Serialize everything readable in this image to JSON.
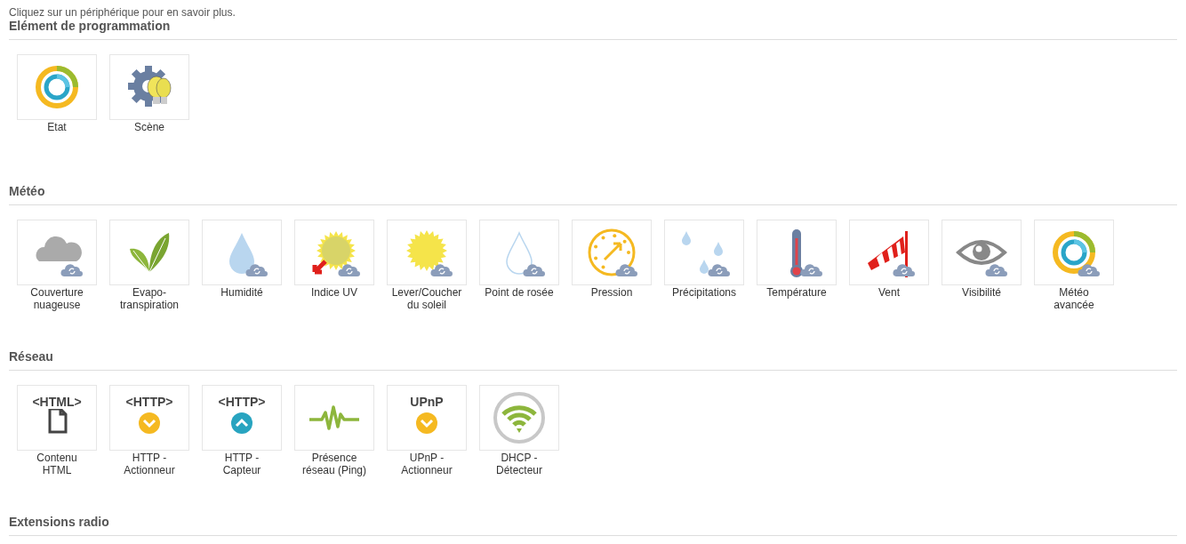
{
  "intro": "Cliquez sur un périphérique pour en savoir plus.",
  "sections": [
    {
      "title": "Elément de programmation",
      "devices": [
        {
          "label": "Etat",
          "kind": "donut",
          "badge": false
        },
        {
          "label": "Scène",
          "kind": "scene",
          "badge": false
        }
      ]
    },
    {
      "title": "Météo",
      "devices": [
        {
          "label": "Couverture\nnuageuse",
          "kind": "cloud",
          "badge": true
        },
        {
          "label": "Evapo-\ntranspiration",
          "kind": "leaf",
          "badge": false
        },
        {
          "label": "Humidité",
          "kind": "drop",
          "badge": true
        },
        {
          "label": "Indice UV",
          "kind": "uv",
          "badge": true
        },
        {
          "label": "Lever/Coucher\ndu soleil",
          "kind": "sun",
          "badge": true
        },
        {
          "label": "Point de rosée",
          "kind": "dew",
          "badge": true
        },
        {
          "label": "Pression",
          "kind": "gauge",
          "badge": true
        },
        {
          "label": "Précipitations",
          "kind": "rain",
          "badge": true
        },
        {
          "label": "Température",
          "kind": "thermometer",
          "badge": true
        },
        {
          "label": "Vent",
          "kind": "windsock",
          "badge": true
        },
        {
          "label": "Visibilité",
          "kind": "eye",
          "badge": true
        },
        {
          "label": "Météo\navancée",
          "kind": "donut",
          "badge": true
        }
      ]
    },
    {
      "title": "Réseau",
      "devices": [
        {
          "label": "Contenu\nHTML",
          "kind": "document",
          "icon_text": "<HTML>",
          "badge": false
        },
        {
          "label": "HTTP -\nActionneur",
          "kind": "down",
          "icon_text": "<HTTP>",
          "badge": false
        },
        {
          "label": "HTTP -\nCapteur",
          "kind": "up",
          "icon_text": "<HTTP>",
          "badge": false
        },
        {
          "label": "Présence\nréseau (Ping)",
          "kind": "pulse",
          "badge": false
        },
        {
          "label": "UPnP -\nActionneur",
          "kind": "down",
          "icon_text": "UPnP",
          "badge": false
        },
        {
          "label": "DHCP -\nDétecteur",
          "kind": "wifi",
          "badge": false
        }
      ]
    },
    {
      "title": "Extensions radio"
    }
  ]
}
